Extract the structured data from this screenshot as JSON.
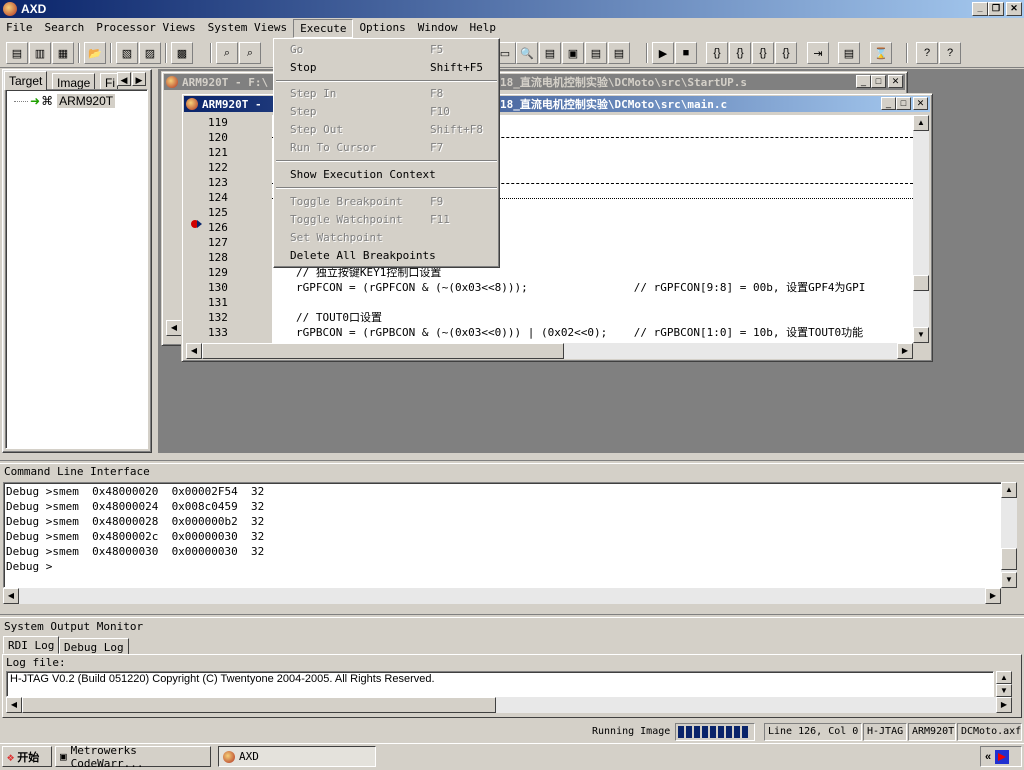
{
  "app": {
    "title": "AXD"
  },
  "menubar": {
    "items": [
      "File",
      "Search",
      "Processor Views",
      "System Views",
      "Execute",
      "Options",
      "Window",
      "Help"
    ]
  },
  "execute_menu": {
    "items": [
      {
        "label": "Go",
        "shortcut": "F5",
        "enabled": false
      },
      {
        "label": "Stop",
        "shortcut": "Shift+F5",
        "enabled": true
      },
      {
        "label": "Step In",
        "shortcut": "F8",
        "enabled": false
      },
      {
        "label": "Step",
        "shortcut": "F10",
        "enabled": false
      },
      {
        "label": "Step Out",
        "shortcut": "Shift+F8",
        "enabled": false
      },
      {
        "label": "Run To Cursor",
        "shortcut": "F7",
        "enabled": false
      },
      {
        "label": "Show Execution Context",
        "shortcut": "",
        "enabled": true
      },
      {
        "label": "Toggle Breakpoint",
        "shortcut": "F9",
        "enabled": false
      },
      {
        "label": "Toggle Watchpoint",
        "shortcut": "F11",
        "enabled": false
      },
      {
        "label": "Set Watchpoint",
        "shortcut": "",
        "enabled": false
      },
      {
        "label": "Delete All Breakpoints",
        "shortcut": "",
        "enabled": true
      }
    ]
  },
  "left_panel": {
    "tabs": [
      "Target",
      "Image",
      "Fi"
    ],
    "tree": [
      {
        "label": "ARM920T"
      }
    ]
  },
  "windows": {
    "back": {
      "title": "ARM920T - F:\\",
      "title_tail": "18_直流电机控制实验\\DCMoto\\src\\StartUP.s"
    },
    "front": {
      "title": "ARM920T -",
      "title_tail": "18_直流电机控制实验\\DCMoto\\src\\main.c"
    }
  },
  "code": {
    "line_numbers": [
      "119",
      "120",
      "121",
      "122",
      "123",
      "124",
      "125",
      "126",
      "127",
      "128",
      "129",
      "130",
      "131",
      "132",
      "133"
    ],
    "lines": [
      "",
      "",
      "",
      "",
      "",
      "",
      "",
      "",
      "",
      "",
      "// 独立按键KEY1控制口设置",
      "rGPFCON = (rGPFCON & (~(0x03<<8)));                // rGPFCON[9:8] = 00b, 设置GPF4为GPI",
      "",
      "// TOUT0口设置",
      "rGPBCON = (rGPBCON & (~(0x03<<0))) | (0x02<<0);    // rGPBCON[1:0] = 10b, 设置TOUT0功能"
    ],
    "current_line": "126"
  },
  "cli": {
    "title": "Command Line Interface",
    "lines": [
      "Debug >smem  0x48000020  0x00002F54  32",
      "Debug >smem  0x48000024  0x008c0459  32",
      "Debug >smem  0x48000028  0x000000b2  32",
      "Debug >smem  0x4800002c  0x00000030  32",
      "Debug >smem  0x48000030  0x00000030  32",
      "Debug >"
    ]
  },
  "output_monitor": {
    "title": "System Output Monitor",
    "tabs": [
      "RDI Log",
      "Debug Log"
    ],
    "log_file_label": "Log file:",
    "log_text": "H-JTAG V0.2 (Build 051220) Copyright (C) Twentyone 2004-2005. All Rights Reserved."
  },
  "statusbar": {
    "running": "Running Image",
    "position": "Line 126, Col 0",
    "target": "H-JTAG",
    "processor": "ARM920T",
    "image": "DCMoto.axf"
  },
  "taskbar": {
    "start": "开始",
    "tasks": [
      "Metrowerks CodeWarr...",
      "AXD"
    ],
    "tray_chevron": "«"
  },
  "colors": {
    "titlebar_start": "#0a246a",
    "titlebar_end": "#a6caf0",
    "breakpoint": "#d00000",
    "progress": "#0a246a"
  }
}
